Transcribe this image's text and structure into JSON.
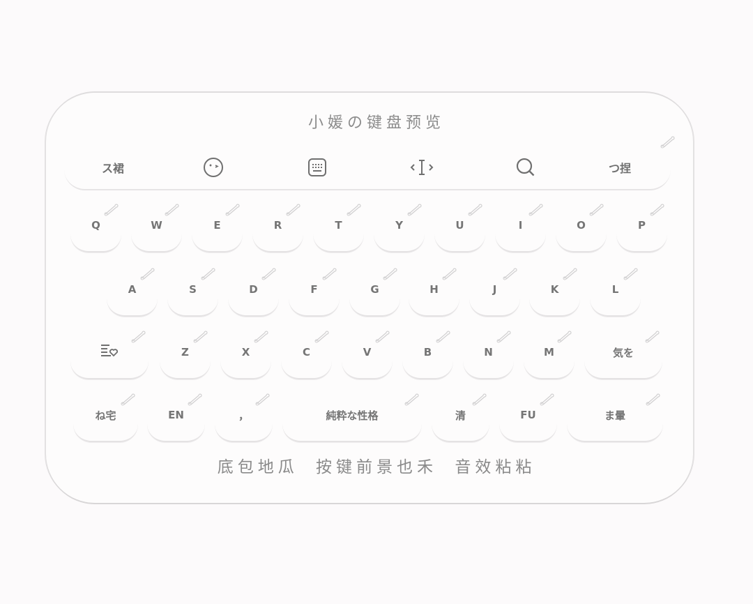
{
  "title": "小媛の键盘预览",
  "toolbar": {
    "left_label": "ス裙",
    "right_label": "つ捏",
    "icons": [
      "emoji-icon",
      "keyboard-icon",
      "cursor-icon",
      "search-icon"
    ]
  },
  "rows": [
    [
      "Q",
      "W",
      "E",
      "R",
      "T",
      "Y",
      "U",
      "I",
      "O",
      "P"
    ],
    [
      "A",
      "S",
      "D",
      "F",
      "G",
      "H",
      "J",
      "K",
      "L"
    ],
    [
      "Z",
      "X",
      "C",
      "V",
      "B",
      "N",
      "M"
    ],
    []
  ],
  "special": {
    "shift_icon": "list-heart-icon",
    "enter_label": "気を",
    "symbol_label": "ね宅",
    "lang_label": "EN",
    "comma_label": "，",
    "space_label": "純粋な性格",
    "clear_label": "清",
    "fu_label": "FU",
    "delete_label": "ま暈"
  },
  "footer": {
    "part1": "底包地瓜",
    "part2": "按键前景也禾",
    "part3": "音效粘粘"
  }
}
